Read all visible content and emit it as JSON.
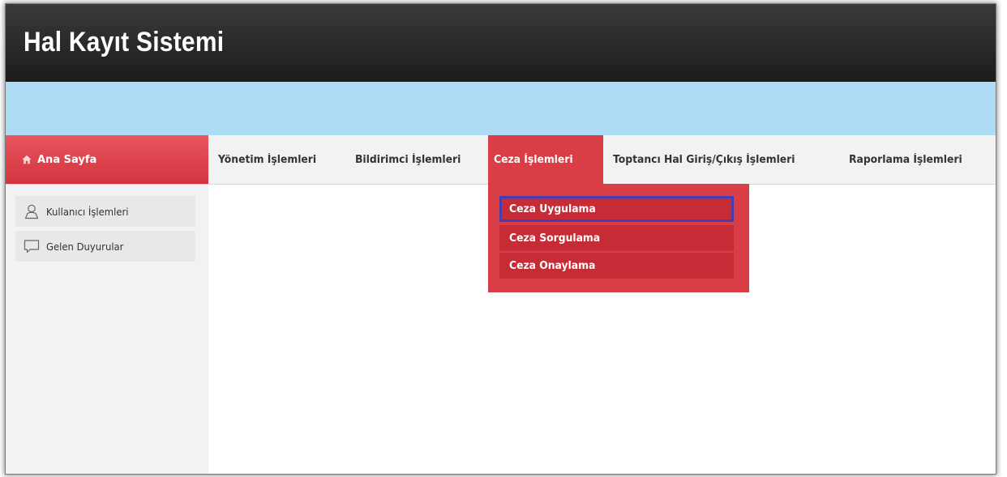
{
  "header": {
    "title": "Hal Kayıt Sistemi"
  },
  "nav": {
    "home": {
      "label": "Ana Sayfa",
      "icon": "home-icon"
    },
    "items": [
      {
        "label": "Yönetim İşlemleri"
      },
      {
        "label": "Bildirimci İşlemleri"
      },
      {
        "label": "Ceza İşlemleri",
        "active": true
      },
      {
        "label": "Toptancı Hal Giriş/Çıkış İşlemleri"
      },
      {
        "label": "Raporlama İşlemleri"
      }
    ]
  },
  "dropdown": {
    "items": [
      {
        "label": "Ceza Uygulama",
        "highlighted": true
      },
      {
        "label": "Ceza Sorgulama"
      },
      {
        "label": "Ceza Onaylama"
      }
    ]
  },
  "sidebar": {
    "items": [
      {
        "label": "Kullanıcı İşlemleri",
        "icon": "user-icon"
      },
      {
        "label": "Gelen Duyurular",
        "icon": "speech-bubble-icon"
      }
    ]
  },
  "colors": {
    "header_bg": "#1c1c1c",
    "band_blue": "#aedcf5",
    "accent_red": "#d93d45",
    "dropdown_item_red": "#c52c35",
    "highlight_border": "#4a3bb0",
    "nav_bg": "#f2f2f2"
  }
}
